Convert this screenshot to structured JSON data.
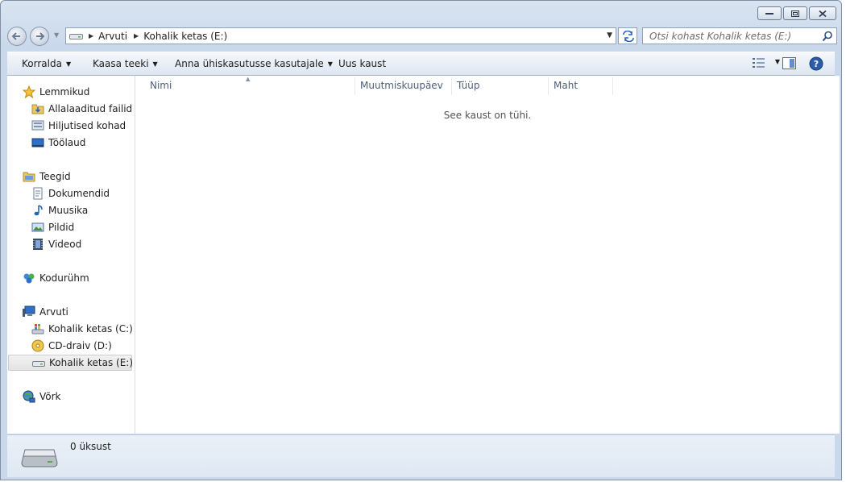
{
  "breadcrumb": {
    "items": [
      "Arvuti",
      "Kohalik ketas (E:)"
    ]
  },
  "search": {
    "placeholder": "Otsi kohast Kohalik ketas (E:)"
  },
  "commandbar": {
    "organize": "Korralda",
    "include_in_library": "Kaasa teeki",
    "share_with": "Anna ühiskasutusse kasutajale",
    "new_folder": "Uus kaust"
  },
  "nav": {
    "favorites": {
      "label": "Lemmikud",
      "items": [
        "Allalaaditud failid",
        "Hiljutised kohad",
        "Töölaud"
      ]
    },
    "libraries": {
      "label": "Teegid",
      "items": [
        "Dokumendid",
        "Muusika",
        "Pildid",
        "Videod"
      ]
    },
    "homegroup": {
      "label": "Kodurühm"
    },
    "computer": {
      "label": "Arvuti",
      "items": [
        "Kohalik ketas (C:)",
        "CD-draiv (D:)",
        "Kohalik ketas (E:)"
      ]
    },
    "network": {
      "label": "Võrk"
    }
  },
  "columns": [
    "Nimi",
    "Muutmiskuupäev",
    "Tüüp",
    "Maht"
  ],
  "content": {
    "empty_message": "See kaust on tühi."
  },
  "details": {
    "item_count": "0 üksust"
  },
  "icons": [
    "back-icon",
    "forward-icon",
    "drive-icon",
    "refresh-icon",
    "search-icon",
    "views-icon",
    "preview-pane-icon",
    "help-icon",
    "star-icon",
    "downloads-folder-icon",
    "recent-places-icon",
    "desktop-icon",
    "library-icon",
    "documents-icon",
    "music-icon",
    "pictures-icon",
    "videos-icon",
    "homegroup-icon",
    "computer-icon",
    "windows-drive-icon",
    "cd-drive-icon",
    "network-icon"
  ]
}
